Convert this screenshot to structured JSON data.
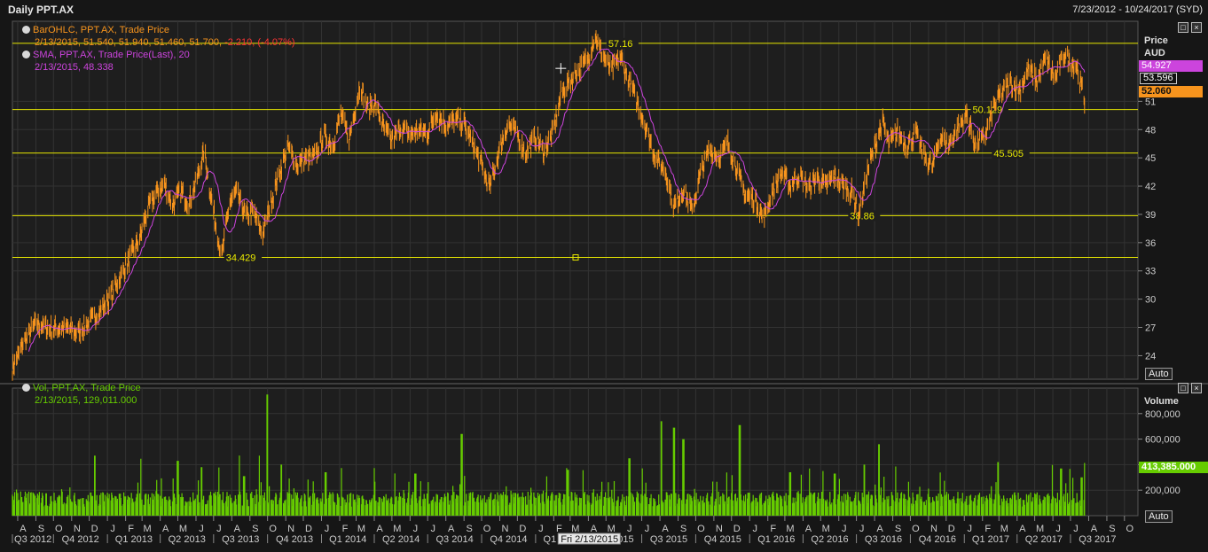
{
  "window": {
    "title": "Daily PPT.AX",
    "date_range": "7/23/2012 - 10/24/2017 (SYD)"
  },
  "price_pane": {
    "legend": {
      "ohlc_title": "BarOHLC, PPT.AX, Trade Price",
      "ohlc_values": "2/13/2015, 51.540, 51.940, 51.460, 51.700,",
      "ohlc_change": "-2.210, (-4.07%)",
      "sma_title": "SMA, PPT.AX, Trade Price(Last),",
      "sma_period": "20",
      "sma_values": "2/13/2015, 48.338"
    },
    "axis_title": "Price",
    "axis_unit": "AUD",
    "badge_sma": "54.927",
    "badge_box": "53.596",
    "badge_last": "52.060",
    "auto_label": "Auto"
  },
  "volume_pane": {
    "legend": {
      "title": "Vol, PPT.AX, Trade Price",
      "values": "2/13/2015, 129,011.000"
    },
    "axis_title": "Volume",
    "badge_last": "413,385.000",
    "auto_label": "Auto"
  },
  "cursor_date": "Fri 2/13/2015",
  "colors": {
    "price": "#f7941d",
    "sma": "#cc44dd",
    "volume": "#66cc00",
    "hline": "#e8e800",
    "grid": "#333333"
  },
  "chart_data": {
    "type": "line",
    "x_range": [
      "2012-07-23",
      "2017-10-24"
    ],
    "price": {
      "series_name": "BarOHLC, PPT.AX, Trade Price",
      "ylim": [
        21.5,
        59.5
      ],
      "y_ticks": [
        24,
        27,
        30,
        33,
        36,
        39,
        42,
        45,
        48,
        51
      ],
      "points": [
        [
          "2012-07-23",
          22.6
        ],
        [
          "2012-08-10",
          25.3
        ],
        [
          "2012-09-01",
          27.4
        ],
        [
          "2012-09-25",
          26.8
        ],
        [
          "2012-10-20",
          27.0
        ],
        [
          "2012-11-10",
          26.4
        ],
        [
          "2012-12-05",
          27.8
        ],
        [
          "2012-12-30",
          29.5
        ],
        [
          "2013-01-20",
          32.0
        ],
        [
          "2013-02-10",
          34.6
        ],
        [
          "2013-02-25",
          36.4
        ],
        [
          "2013-03-10",
          39.4
        ],
        [
          "2013-03-25",
          41.2
        ],
        [
          "2013-04-08",
          42.3
        ],
        [
          "2013-04-22",
          40.0
        ],
        [
          "2013-05-06",
          41.4
        ],
        [
          "2013-05-20",
          40.2
        ],
        [
          "2013-06-03",
          42.8
        ],
        [
          "2013-06-15",
          45.8
        ],
        [
          "2013-06-25",
          41.5
        ],
        [
          "2013-07-05",
          37.8
        ],
        [
          "2013-07-15",
          34.4
        ],
        [
          "2013-07-28",
          40.3
        ],
        [
          "2013-08-10",
          41.3
        ],
        [
          "2013-08-25",
          38.8
        ],
        [
          "2013-09-08",
          39.2
        ],
        [
          "2013-09-22",
          36.8
        ],
        [
          "2013-10-05",
          39.8
        ],
        [
          "2013-10-20",
          43.2
        ],
        [
          "2013-11-05",
          46.2
        ],
        [
          "2013-11-20",
          44.2
        ],
        [
          "2013-12-05",
          44.9
        ],
        [
          "2013-12-20",
          45.1
        ],
        [
          "2014-01-05",
          47.4
        ],
        [
          "2014-01-20",
          46.3
        ],
        [
          "2014-02-03",
          49.6
        ],
        [
          "2014-02-17",
          47.0
        ],
        [
          "2014-03-01",
          50.7
        ],
        [
          "2014-03-08",
          52.8
        ],
        [
          "2014-03-20",
          50.3
        ],
        [
          "2014-04-03",
          50.8
        ],
        [
          "2014-04-17",
          48.1
        ],
        [
          "2014-05-01",
          46.8
        ],
        [
          "2014-05-15",
          48.2
        ],
        [
          "2014-06-01",
          47.4
        ],
        [
          "2014-06-15",
          48.0
        ],
        [
          "2014-07-01",
          47.6
        ],
        [
          "2014-07-15",
          49.8
        ],
        [
          "2014-08-01",
          48.4
        ],
        [
          "2014-08-15",
          49.0
        ],
        [
          "2014-09-01",
          48.6
        ],
        [
          "2014-09-15",
          46.6
        ],
        [
          "2014-10-01",
          44.2
        ],
        [
          "2014-10-15",
          41.8
        ],
        [
          "2014-11-01",
          46.0
        ],
        [
          "2014-11-15",
          48.6
        ],
        [
          "2014-12-01",
          47.4
        ],
        [
          "2014-12-15",
          45.5
        ],
        [
          "2015-01-01",
          47.3
        ],
        [
          "2015-01-15",
          45.6
        ],
        [
          "2015-02-01",
          48.0
        ],
        [
          "2015-02-13",
          51.7
        ],
        [
          "2015-03-01",
          53.2
        ],
        [
          "2015-03-15",
          54.4
        ],
        [
          "2015-04-01",
          55.6
        ],
        [
          "2015-04-12",
          58.0
        ],
        [
          "2015-04-25",
          56.0
        ],
        [
          "2015-05-10",
          54.2
        ],
        [
          "2015-05-25",
          55.8
        ],
        [
          "2015-06-10",
          53.0
        ],
        [
          "2015-06-25",
          50.6
        ],
        [
          "2015-07-10",
          47.8
        ],
        [
          "2015-07-25",
          45.0
        ],
        [
          "2015-08-10",
          43.6
        ],
        [
          "2015-08-25",
          39.8
        ],
        [
          "2015-09-10",
          41.6
        ],
        [
          "2015-09-25",
          39.4
        ],
        [
          "2015-10-10",
          43.6
        ],
        [
          "2015-10-25",
          46.0
        ],
        [
          "2015-11-10",
          45.0
        ],
        [
          "2015-11-25",
          46.6
        ],
        [
          "2015-12-10",
          43.8
        ],
        [
          "2015-12-25",
          41.0
        ],
        [
          "2016-01-10",
          40.6
        ],
        [
          "2016-01-25",
          38.6
        ],
        [
          "2016-02-10",
          41.6
        ],
        [
          "2016-02-25",
          43.4
        ],
        [
          "2016-03-10",
          42.0
        ],
        [
          "2016-03-25",
          43.2
        ],
        [
          "2016-04-10",
          41.8
        ],
        [
          "2016-04-25",
          42.9
        ],
        [
          "2016-05-10",
          42.0
        ],
        [
          "2016-05-25",
          43.0
        ],
        [
          "2016-06-10",
          42.0
        ],
        [
          "2016-06-25",
          41.2
        ],
        [
          "2016-07-05",
          39.0
        ],
        [
          "2016-07-20",
          43.6
        ],
        [
          "2016-08-05",
          47.0
        ],
        [
          "2016-08-15",
          48.8
        ],
        [
          "2016-08-25",
          46.4
        ],
        [
          "2016-09-10",
          47.8
        ],
        [
          "2016-09-25",
          46.2
        ],
        [
          "2016-10-10",
          47.6
        ],
        [
          "2016-10-25",
          45.2
        ],
        [
          "2016-11-08",
          44.0
        ],
        [
          "2016-11-20",
          47.3
        ],
        [
          "2016-12-05",
          46.4
        ],
        [
          "2016-12-20",
          48.0
        ],
        [
          "2017-01-05",
          49.6
        ],
        [
          "2017-01-20",
          46.4
        ],
        [
          "2017-02-05",
          47.2
        ],
        [
          "2017-02-20",
          50.4
        ],
        [
          "2017-03-05",
          51.8
        ],
        [
          "2017-03-20",
          53.0
        ],
        [
          "2017-04-05",
          52.2
        ],
        [
          "2017-04-20",
          54.4
        ],
        [
          "2017-05-05",
          53.2
        ],
        [
          "2017-05-20",
          55.6
        ],
        [
          "2017-06-05",
          53.4
        ],
        [
          "2017-06-20",
          56.0
        ],
        [
          "2017-07-01",
          55.2
        ],
        [
          "2017-07-12",
          54.6
        ],
        [
          "2017-07-25",
          51.0
        ]
      ]
    },
    "sma": {
      "name": "SMA, PPT.AX, Trade Price(Last), 20",
      "period": 20
    },
    "horizontal_lines": [
      {
        "value": 57.16,
        "label": "57.16",
        "label_date": "2015-05-05"
      },
      {
        "value": 50.129,
        "label": "50.129",
        "label_date": "2017-01-15"
      },
      {
        "value": 45.505,
        "label": "45.505",
        "label_date": "2017-02-20"
      },
      {
        "value": 38.86,
        "label": "38.86",
        "label_date": "2016-06-20"
      },
      {
        "value": 34.429,
        "label": "34.429",
        "label_date": "2013-07-22"
      }
    ],
    "volume": {
      "series_name": "Vol, PPT.AX, Trade Price",
      "ylim": [
        0,
        1000000
      ],
      "y_ticks": [
        200000,
        400000,
        600000,
        800000
      ],
      "y_tick_labels": [
        "200,000",
        "",
        "600,000",
        "800,000"
      ],
      "base": 130000,
      "spikes": [
        [
          "2012-12-10",
          470000
        ],
        [
          "2013-05-01",
          430000
        ],
        [
          "2013-06-10",
          380000
        ],
        [
          "2013-08-22",
          310000
        ],
        [
          "2013-09-30",
          950000
        ],
        [
          "2013-10-25",
          400000
        ],
        [
          "2014-01-08",
          340000
        ],
        [
          "2014-06-10",
          330000
        ],
        [
          "2014-08-28",
          640000
        ],
        [
          "2015-02-25",
          360000
        ],
        [
          "2015-06-10",
          450000
        ],
        [
          "2015-08-03",
          740000
        ],
        [
          "2015-08-25",
          690000
        ],
        [
          "2015-09-10",
          600000
        ],
        [
          "2015-12-15",
          710000
        ],
        [
          "2016-03-10",
          340000
        ],
        [
          "2016-05-25",
          330000
        ],
        [
          "2016-07-15",
          400000
        ],
        [
          "2016-08-08",
          560000
        ],
        [
          "2017-02-27",
          420000
        ],
        [
          "2017-06-15",
          370000
        ],
        [
          "2017-07-20",
          300000
        ],
        [
          "2017-07-26",
          413385
        ]
      ]
    },
    "x_months": [
      "A",
      "S",
      "O",
      "N",
      "D",
      "J",
      "F",
      "M",
      "A",
      "M",
      "J",
      "J",
      "A",
      "S",
      "O",
      "N",
      "D",
      "J",
      "F",
      "M",
      "A",
      "M",
      "J",
      "J",
      "A",
      "S",
      "O",
      "N",
      "D",
      "J",
      "F",
      "M",
      "A",
      "M",
      "J",
      "J",
      "A",
      "S",
      "O",
      "N",
      "D",
      "J",
      "F",
      "M",
      "A",
      "M",
      "J",
      "J",
      "A",
      "S",
      "O",
      "N",
      "D",
      "J",
      "F",
      "M",
      "A",
      "M",
      "J",
      "J",
      "A",
      "S",
      "O"
    ],
    "x_quarters": [
      "Q3 2012",
      "Q4 2012",
      "Q1 2013",
      "Q2 2013",
      "Q3 2013",
      "Q4 2013",
      "Q1 2014",
      "Q2 2014",
      "Q3 2014",
      "Q4 2014",
      "Q1 2015",
      "Q2 2015",
      "Q3 2015",
      "Q4 2015",
      "Q1 2016",
      "Q2 2016",
      "Q3 2016",
      "Q4 2016",
      "Q1 2017",
      "Q2 2017",
      "Q3 2017"
    ]
  }
}
